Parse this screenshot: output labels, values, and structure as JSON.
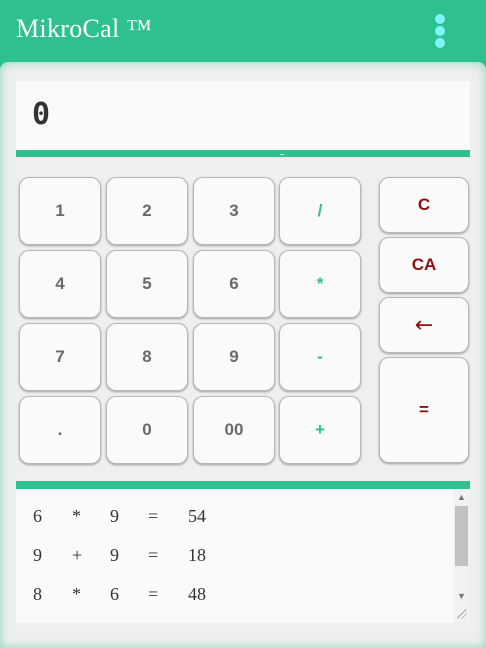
{
  "header": {
    "title": "MikroCal ™",
    "menu_icon": "kebab-menu-icon",
    "menu_dot_color": "#7ef3f6"
  },
  "colors": {
    "accent": "#2ec08e",
    "clear_keys": "#8b1010",
    "digit_keys": "#6a6a6a"
  },
  "display": {
    "value": "0"
  },
  "keypad": {
    "digits": {
      "k1": "1",
      "k2": "2",
      "k3": "3",
      "k4": "4",
      "k5": "5",
      "k6": "6",
      "k7": "7",
      "k8": "8",
      "k9": "9",
      "dot": ".",
      "k0": "0",
      "k00": "00"
    },
    "ops": {
      "divide": "/",
      "multiply": "*",
      "subtract": "-",
      "add": "+"
    },
    "side": {
      "clear": "C",
      "clear_all": "CA",
      "backspace": "←",
      "equals": "="
    }
  },
  "history": {
    "rows": [
      {
        "a": "6",
        "op": "*",
        "b": "9",
        "eq": "=",
        "result": "54"
      },
      {
        "a": "9",
        "op": "+",
        "b": "9",
        "eq": "=",
        "result": "18"
      },
      {
        "a": "8",
        "op": "*",
        "b": "6",
        "eq": "=",
        "result": "48"
      }
    ],
    "scroll_up_icon": "▲",
    "scroll_down_icon": "▼"
  }
}
